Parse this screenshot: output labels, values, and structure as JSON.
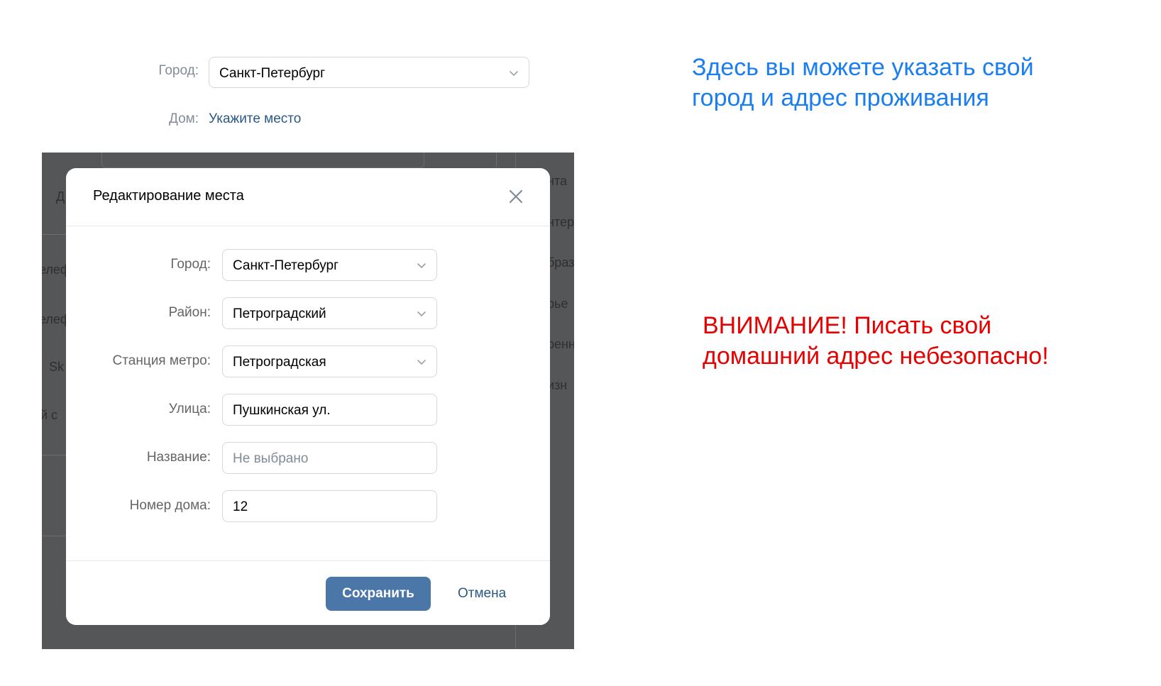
{
  "top_form": {
    "city_label": "Город:",
    "city_value": "Санкт-Петербург",
    "home_label": "Дом:",
    "home_link": "Укажите место"
  },
  "annotations": {
    "info_line1": "Здесь вы можете указать свой",
    "info_line2": "город и адрес проживания",
    "warning_line1": "ВНИМАНИЕ! Писать свой",
    "warning_line2": "домашний адрес небезопасно!"
  },
  "background_fragments": {
    "f1": "нта",
    "f2": "нтер",
    "f3": "браз",
    "f4": "рье",
    "f5": "ренн",
    "f6": "изн",
    "f7": "елеф",
    "f8": "елеф",
    "f9": "Sk",
    "f10": "й с",
    "f11": "Д"
  },
  "modal": {
    "title": "Редактирование места",
    "close_icon": "close-icon",
    "fields": {
      "city": {
        "label": "Город:",
        "value": "Санкт-Петербург",
        "type": "select"
      },
      "district": {
        "label": "Район:",
        "value": "Петроградский",
        "type": "select"
      },
      "metro": {
        "label": "Станция метро:",
        "value": "Петроградская",
        "type": "select"
      },
      "street": {
        "label": "Улица:",
        "value": "Пушкинская ул.",
        "type": "text"
      },
      "name": {
        "label": "Название:",
        "placeholder": "Не выбрано",
        "type": "text"
      },
      "house": {
        "label": "Номер дома:",
        "value": "12",
        "type": "text"
      }
    },
    "save_label": "Сохранить",
    "cancel_label": "Отмена"
  },
  "colors": {
    "accent": "#4a76a8",
    "link": "#2a5885",
    "info_text": "#1a7df0",
    "warning_text": "#e80000",
    "overlay": "#555657"
  }
}
